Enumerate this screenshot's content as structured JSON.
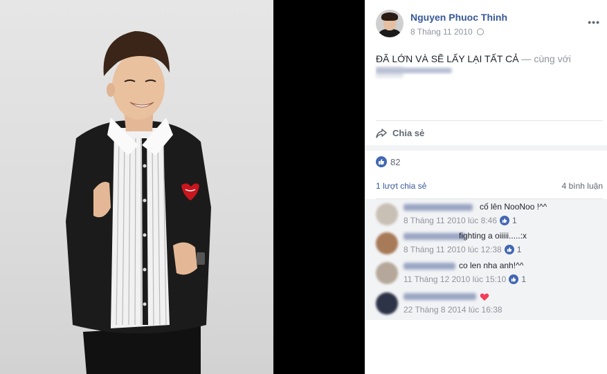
{
  "post": {
    "author": "Nguyen Phuoc Thinh",
    "date": "8 Tháng 11 2010",
    "text": "ĐÃ LỚN VÀ SẼ LẤY LẠI TẤT CẢ",
    "with_text": " — cùng với",
    "share_label": "Chia sẻ",
    "like_count": "82",
    "shares_text": "1 lượt chia sẻ",
    "comments_text": "4 bình luận"
  },
  "comments": [
    {
      "text": "cố lên NooNoo !^^",
      "time": "8 Tháng 11 2010 lúc 8:46",
      "likes": "1"
    },
    {
      "text": "fighting a oiiiii.....:x",
      "time": "8 Tháng 11 2010 lúc 12:38",
      "likes": "1"
    },
    {
      "text": "co len nha anh!^^",
      "time": "11 Tháng 12 2010 lúc 15:10",
      "likes": "1"
    },
    {
      "text": "",
      "time": "22 Tháng 8 2014 lúc 16:38",
      "likes": ""
    }
  ],
  "colors": {
    "link": "#365899",
    "like_blue": "#4267b2",
    "heart": "#f33e58"
  },
  "icons": [
    "globe-icon",
    "more-icon",
    "share-icon",
    "like-icon",
    "heart-icon"
  ]
}
